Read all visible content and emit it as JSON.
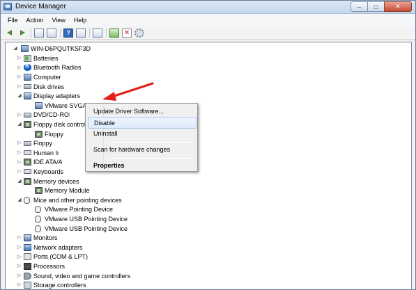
{
  "window": {
    "title": "Device Manager",
    "controls": {
      "minimize": "–",
      "maximize": "□",
      "close": "✕"
    }
  },
  "menu": [
    "File",
    "Action",
    "View",
    "Help"
  ],
  "toolbar": {
    "icons": [
      "back-icon",
      "forward-icon",
      "show-hide-console-tree-icon",
      "properties-icon",
      "help-icon",
      "show-hidden-icon",
      "scan-hardware-icon",
      "update-driver-icon",
      "uninstall-icon",
      "disable-icon"
    ]
  },
  "tree": {
    "root": "WIN-D6PQUTKSF3D",
    "rows": [
      {
        "label": "Batteries",
        "icon": "battery-icon"
      },
      {
        "label": "Bluetooth Radios",
        "icon": "bluetooth-icon"
      },
      {
        "label": "Computer",
        "icon": "computer-icon"
      },
      {
        "label": "Disk drives",
        "icon": "disk-drive-icon"
      },
      {
        "label": "Display adapters",
        "icon": "display-adapter-icon"
      },
      {
        "label": "VMware SVGA 3D",
        "icon": "display-adapter-icon"
      },
      {
        "label": "DVD/CD-ROM drives",
        "icon": "dvd-drive-icon"
      },
      {
        "label": "Floppy disk controllers",
        "icon": "floppy-controller-icon"
      },
      {
        "label": "Floppy disk controller",
        "icon": "floppy-controller-icon"
      },
      {
        "label": "Floppy drive controllers",
        "icon": "floppy-drive-icon"
      },
      {
        "label": "Human Interface Devices",
        "icon": "hid-icon"
      },
      {
        "label": "IDE ATA/ATAPI controllers",
        "icon": "ide-controller-icon"
      },
      {
        "label": "Keyboards",
        "icon": "keyboard-icon"
      },
      {
        "label": "Memory devices",
        "icon": "memory-icon"
      },
      {
        "label": "Memory Module",
        "icon": "memory-icon"
      },
      {
        "label": "Mice and other pointing devices",
        "icon": "mouse-icon"
      },
      {
        "label": "VMware Pointing Device",
        "icon": "mouse-icon"
      },
      {
        "label": "VMware USB Pointing Device",
        "icon": "mouse-icon"
      },
      {
        "label": "VMware USB Pointing Device",
        "icon": "mouse-icon"
      },
      {
        "label": "Monitors",
        "icon": "monitor-icon"
      },
      {
        "label": "Network adapters",
        "icon": "network-adapter-icon"
      },
      {
        "label": "Ports (COM & LPT)",
        "icon": "port-icon"
      },
      {
        "label": "Processors",
        "icon": "processor-icon"
      },
      {
        "label": "Sound, video and game controllers",
        "icon": "sound-icon"
      },
      {
        "label": "Storage controllers",
        "icon": "storage-controller-icon"
      }
    ]
  },
  "context_menu": {
    "items": [
      {
        "label": "Update Driver Software...",
        "highlighted": false,
        "bold": false
      },
      {
        "label": "Disable",
        "highlighted": true,
        "bold": false
      },
      {
        "label": "Uninstall",
        "highlighted": false,
        "bold": false
      },
      {
        "label": "Scan for hardware changes",
        "highlighted": false,
        "bold": false
      },
      {
        "label": "Properties",
        "highlighted": false,
        "bold": true
      }
    ]
  },
  "annotation": {
    "arrow_color": "#e0201b"
  }
}
